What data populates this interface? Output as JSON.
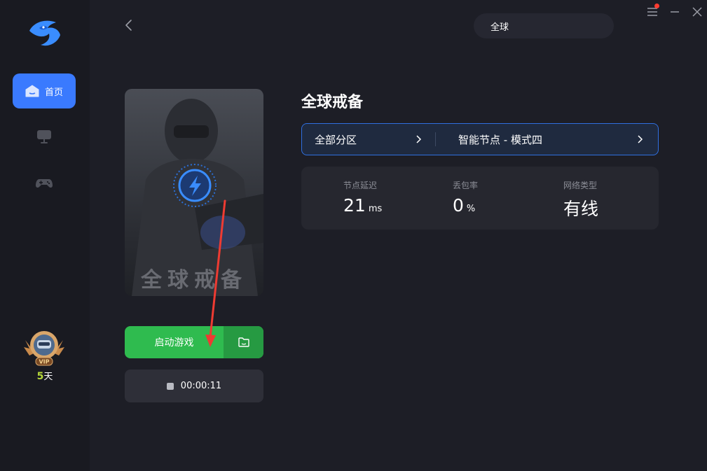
{
  "sidebar": {
    "items": [
      {
        "label": "首页",
        "icon": "home-icon",
        "active": true
      },
      {
        "label": "",
        "icon": "monitor-icon",
        "active": false
      },
      {
        "label": "",
        "icon": "gamepad-icon",
        "active": false
      }
    ],
    "vip": {
      "badge": "VIP",
      "days": "5",
      "days_unit": "天"
    }
  },
  "search": {
    "value": "全球"
  },
  "game": {
    "title": "全球戒备",
    "cover_text": "全球戒备",
    "launch_label": "启动游戏",
    "timer": "00:00:11"
  },
  "selector": {
    "region": "全部分区",
    "node": "智能节点 - 模式四"
  },
  "stats": [
    {
      "label": "节点延迟",
      "value": "21",
      "unit": "ms"
    },
    {
      "label": "丢包率",
      "value": "0",
      "unit": "%"
    },
    {
      "label": "网络类型",
      "value": "有线",
      "unit": ""
    }
  ],
  "colors": {
    "accent": "#3a7afe",
    "launch": "#2fbb4f",
    "launch_dark": "#269a42",
    "background": "#1d1e26",
    "sidebar": "#191a21",
    "notification": "#ff3b30"
  }
}
